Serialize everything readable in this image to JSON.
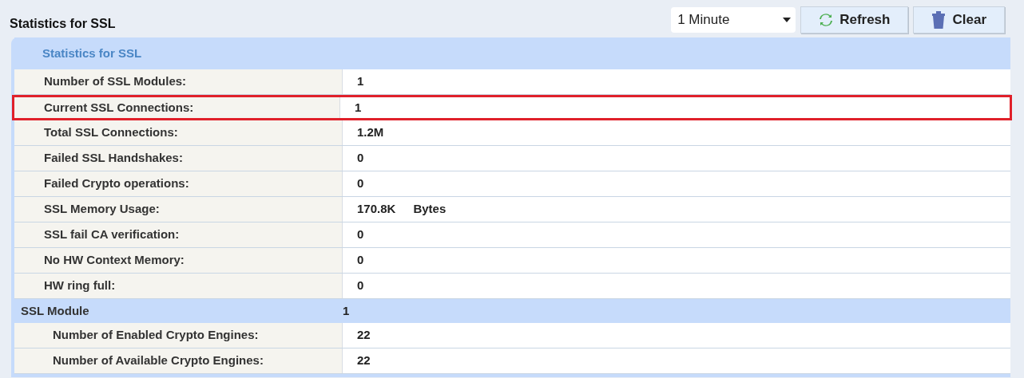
{
  "title": "Statistics for SSL",
  "interval": {
    "value": "1 Minute"
  },
  "buttons": [
    {
      "label": "Refresh",
      "kind": "refresh"
    },
    {
      "label": "Clear",
      "kind": "clear"
    }
  ],
  "sections": [
    {
      "title": "Statistics for SSL",
      "kind": "heading",
      "rows": [
        {
          "label": "Number of SSL Modules:",
          "value": "1",
          "highlighted": false
        },
        {
          "label": "Current SSL Connections:",
          "value": "1",
          "highlighted": true
        },
        {
          "label": "Total SSL Connections:",
          "value": "1.2M",
          "highlighted": false
        },
        {
          "label": "Failed SSL Handshakes:",
          "value": "0",
          "highlighted": false
        },
        {
          "label": "Failed Crypto operations:",
          "value": "0",
          "highlighted": false
        },
        {
          "label": "SSL Memory Usage:",
          "value": "170.8K",
          "unit": "Bytes",
          "highlighted": false
        },
        {
          "label": "SSL fail CA verification:",
          "value": "0",
          "highlighted": false
        },
        {
          "label": "No HW Context Memory:",
          "value": "0",
          "highlighted": false
        },
        {
          "label": "HW ring full:",
          "value": "0",
          "highlighted": false
        }
      ]
    },
    {
      "title": "SSL Module",
      "value": "1",
      "kind": "group",
      "rows": [
        {
          "label": "Number of Enabled Crypto Engines:",
          "value": "22",
          "highlighted": false
        },
        {
          "label": "Number of Available Crypto Engines:",
          "value": "22",
          "highlighted": false
        }
      ]
    }
  ]
}
